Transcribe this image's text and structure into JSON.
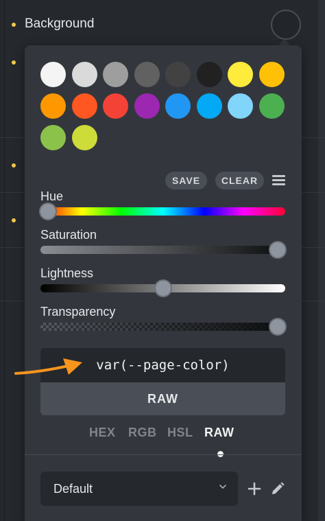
{
  "property": {
    "label": "Background"
  },
  "swatches": [
    {
      "color": "#f4f4f4"
    },
    {
      "color": "#dadada"
    },
    {
      "color": "#9e9e9e"
    },
    {
      "color": "#616161"
    },
    {
      "color": "#424242"
    },
    {
      "color": "#212121"
    },
    {
      "color": "#ffeb3b"
    },
    {
      "color": "#ffc107"
    },
    {
      "color": "#ff9800"
    },
    {
      "color": "#ff5722"
    },
    {
      "color": "#f44336"
    },
    {
      "color": "#9c27b0"
    },
    {
      "color": "#2196f3"
    },
    {
      "color": "#03a9f4"
    },
    {
      "color": "#81d4fa"
    },
    {
      "color": "#4caf50"
    },
    {
      "color": "#8bc34a"
    },
    {
      "color": "#cddc39"
    }
  ],
  "actions": {
    "save_label": "SAVE",
    "clear_label": "CLEAR"
  },
  "sliders": {
    "hue": {
      "label": "Hue",
      "value": 0.03
    },
    "saturation": {
      "label": "Saturation",
      "value": 0.97
    },
    "lightness": {
      "label": "Lightness",
      "value": 0.5
    },
    "transparency": {
      "label": "Transparency",
      "value": 0.97
    }
  },
  "color_value": "var(--page-color)",
  "raw_button_label": "RAW",
  "formats": [
    {
      "label": "HEX",
      "active": false
    },
    {
      "label": "RGB",
      "active": false
    },
    {
      "label": "HSL",
      "active": false
    },
    {
      "label": "RAW",
      "active": true
    }
  ],
  "palette_select": {
    "value": "Default"
  },
  "colors": {
    "accent_bullet": "#f2c94c",
    "annotation_arrow": "#f7941d"
  },
  "icons": [
    "menu-icon",
    "chevron-down-icon",
    "plus-icon",
    "pencil-icon",
    "arrow-annotation-icon"
  ]
}
